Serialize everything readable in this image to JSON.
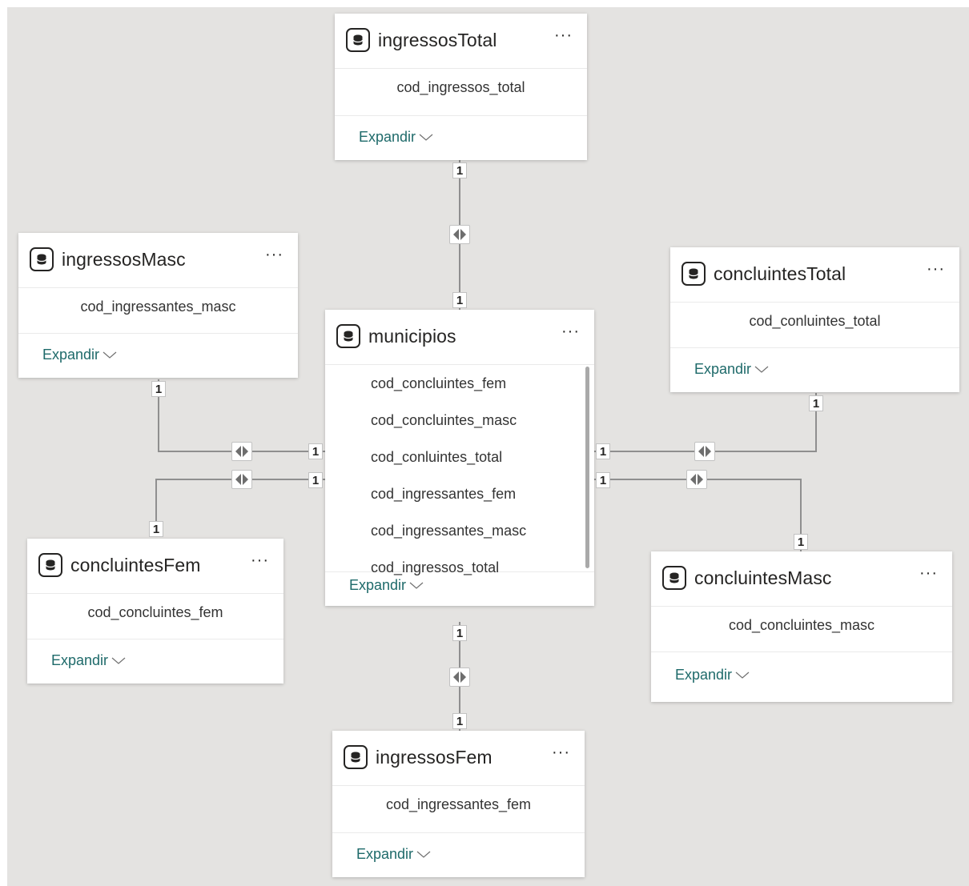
{
  "diagram": {
    "tables": {
      "ingressosTotal": {
        "title": "ingressosTotal",
        "fields": [
          "cod_ingressos_total"
        ],
        "expand_label": "Expandir"
      },
      "ingressosMasc": {
        "title": "ingressosMasc",
        "fields": [
          "cod_ingressantes_masc"
        ],
        "expand_label": "Expandir"
      },
      "concluintesTotal": {
        "title": "concluintesTotal",
        "fields": [
          "cod_conluintes_total"
        ],
        "expand_label": "Expandir"
      },
      "municipios": {
        "title": "municipios",
        "fields": [
          "cod_concluintes_fem",
          "cod_concluintes_masc",
          "cod_conluintes_total",
          "cod_ingressantes_fem",
          "cod_ingressantes_masc",
          "cod_ingressos_total"
        ],
        "expand_label": "Expandir"
      },
      "concluintesFem": {
        "title": "concluintesFem",
        "fields": [
          "cod_concluintes_fem"
        ],
        "expand_label": "Expandir"
      },
      "concluintesMasc": {
        "title": "concluintesMasc",
        "fields": [
          "cod_concluintes_masc"
        ],
        "expand_label": "Expandir"
      },
      "ingressosFem": {
        "title": "ingressosFem",
        "fields": [
          "cod_ingressantes_fem"
        ],
        "expand_label": "Expandir"
      }
    },
    "relationships": [
      {
        "name": "ingressosTotal-municipios",
        "from_cardinality": "1",
        "to_cardinality": "1",
        "cross_filter": "both"
      },
      {
        "name": "ingressosMasc-municipios",
        "from_cardinality": "1",
        "to_cardinality": "1",
        "cross_filter": "both"
      },
      {
        "name": "concluintesFem-municipios",
        "from_cardinality": "1",
        "to_cardinality": "1",
        "cross_filter": "both"
      },
      {
        "name": "concluintesTotal-municipios",
        "from_cardinality": "1",
        "to_cardinality": "1",
        "cross_filter": "both"
      },
      {
        "name": "concluintesMasc-municipios",
        "from_cardinality": "1",
        "to_cardinality": "1",
        "cross_filter": "both"
      },
      {
        "name": "ingressosFem-municipios",
        "from_cardinality": "1",
        "to_cardinality": "1",
        "cross_filter": "both"
      }
    ],
    "icons": {
      "table": "database-icon",
      "more": "more-options-icon",
      "expand": "chevron-down-icon",
      "cross_filter": "bidirectional-filter-icon"
    }
  }
}
